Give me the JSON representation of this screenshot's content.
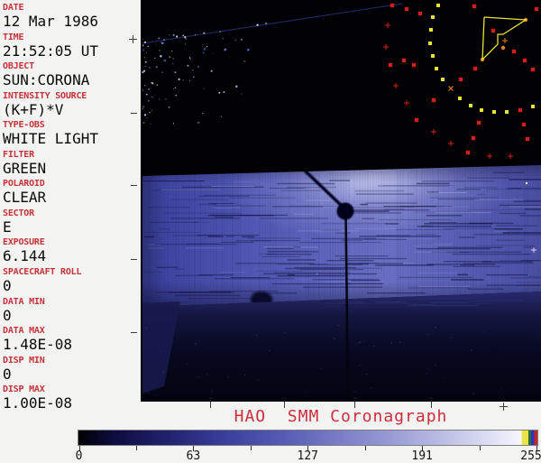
{
  "metadata_panel": {
    "label_color": "#c5323a",
    "value_color": "#0a0a0a",
    "fields": [
      {
        "label": "DATE",
        "value": "12 Mar 1986"
      },
      {
        "label": "TIME",
        "value": "21:52:05 UT"
      },
      {
        "label": "OBJECT",
        "value": "SUN:CORONA"
      },
      {
        "label": "INTENSITY SOURCE",
        "value": "(K+F)*V"
      },
      {
        "label": "TYPE-OBS",
        "value": "WHITE LIGHT"
      },
      {
        "label": "FILTER",
        "value": "GREEN"
      },
      {
        "label": "POLAROID",
        "value": "CLEAR"
      },
      {
        "label": "SECTOR",
        "value": "E"
      },
      {
        "label": "EXPOSURE",
        "value": "6.144"
      },
      {
        "label": "SPACECRAFT ROLL",
        "value": "0"
      },
      {
        "label": "DATA MIN",
        "value": "0"
      },
      {
        "label": "DATA MAX",
        "value": "1.48E-08"
      },
      {
        "label": "DISP MIN",
        "value": "0"
      },
      {
        "label": "DISP MAX",
        "value": "1.00E-08"
      }
    ]
  },
  "title": {
    "text": "HAO  SMM Coronagraph",
    "color": "#cf2c3e"
  },
  "colorbar": {
    "min": 0,
    "max": 255,
    "tick_labels": [
      "0",
      "63",
      "127",
      "191",
      "255"
    ],
    "gradient_stops": [
      [
        "#000003",
        0
      ],
      [
        "#0d0d42",
        8
      ],
      [
        "#222370",
        20
      ],
      [
        "#3c41a0",
        33
      ],
      [
        "#585cb4",
        45
      ],
      [
        "#7478c4",
        55
      ],
      [
        "#989bd4",
        68
      ],
      [
        "#bdbfe5",
        80
      ],
      [
        "#dfe0f4",
        90
      ],
      [
        "#f6f6fd",
        96.4
      ]
    ],
    "end_stripes": [
      [
        "#e8e446",
        96.8,
        98.0
      ],
      [
        "#2e6b35",
        98.0,
        98.6
      ],
      [
        "#2a35c8",
        98.6,
        99.3
      ],
      [
        "#c82525",
        99.3,
        100
      ]
    ]
  },
  "image_view": {
    "background": "#010103",
    "band_color": "#5a60b8",
    "marker_colors": {
      "red": "#d41e1e",
      "yellow": "#e8e431",
      "orange": "#e08020",
      "white": "#ffffff"
    },
    "markers": {
      "red_squares": [
        [
          279,
          6
        ],
        [
          295,
          10
        ],
        [
          310,
          15
        ],
        [
          370,
          7
        ],
        [
          439,
          10
        ],
        [
          292,
          67
        ],
        [
          277,
          72
        ],
        [
          303,
          72
        ],
        [
          371,
          76
        ],
        [
          414,
          57
        ],
        [
          426,
          67
        ],
        [
          435,
          77
        ],
        [
          355,
          88
        ],
        [
          391,
          34
        ],
        [
          325,
          111
        ],
        [
          421,
          122
        ],
        [
          306,
          133
        ],
        [
          375,
          136
        ],
        [
          425,
          138
        ],
        [
          369,
          153
        ],
        [
          429,
          154
        ],
        [
          363,
          169
        ]
      ],
      "yellow_squares": [
        [
          330,
          6
        ],
        [
          324,
          19
        ],
        [
          322,
          33
        ],
        [
          321,
          48
        ],
        [
          324,
          62
        ],
        [
          328,
          76
        ],
        [
          335,
          88
        ],
        [
          354,
          109
        ],
        [
          366,
          117
        ],
        [
          378,
          122
        ],
        [
          392,
          124
        ],
        [
          406,
          124
        ],
        [
          435,
          118
        ]
      ],
      "red_crosses": [
        [
          274,
          28
        ],
        [
          272,
          52
        ],
        [
          283,
          95
        ],
        [
          295,
          114
        ],
        [
          325,
          146
        ],
        [
          344,
          159
        ],
        [
          387,
          173
        ],
        [
          410,
          173
        ]
      ],
      "orange_dots": [
        [
          427,
          22
        ],
        [
          379,
          66
        ],
        [
          402,
          53
        ]
      ],
      "orange_crosses": [
        [
          404,
          45
        ]
      ],
      "orange_x": [
        [
          344,
          98
        ]
      ],
      "white_speck_dot": [
        428,
        203
      ],
      "white_speck_cross": [
        436,
        277
      ]
    },
    "overlay_polygon": [
      [
        381,
        19
      ],
      [
        427,
        22
      ],
      [
        402,
        38
      ],
      [
        396,
        38
      ],
      [
        396,
        49
      ],
      [
        379,
        66
      ]
    ]
  }
}
